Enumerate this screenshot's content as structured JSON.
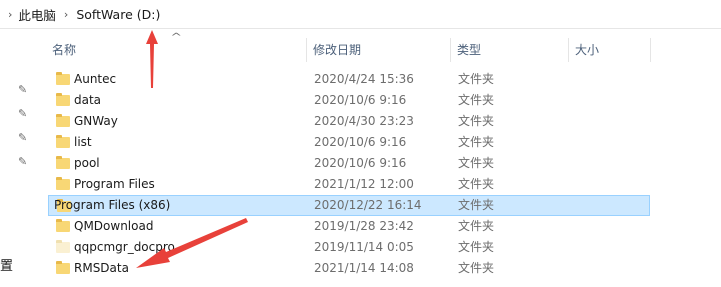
{
  "breadcrumb": {
    "items": [
      "此电脑",
      "SoftWare (D:)"
    ]
  },
  "columns": {
    "name": "名称",
    "date": "修改日期",
    "type": "类型",
    "size": "大小"
  },
  "side_text": "置",
  "files": [
    {
      "name": "Auntec",
      "date": "2020/4/24 15:36",
      "type": "文件夹"
    },
    {
      "name": "data",
      "date": "2020/10/6 9:16",
      "type": "文件夹"
    },
    {
      "name": "GNWay",
      "date": "2020/4/30 23:23",
      "type": "文件夹"
    },
    {
      "name": "list",
      "date": "2020/10/6 9:16",
      "type": "文件夹"
    },
    {
      "name": "pool",
      "date": "2020/10/6 9:16",
      "type": "文件夹"
    },
    {
      "name": "Program Files",
      "date": "2021/1/12 12:00",
      "type": "文件夹"
    },
    {
      "name": "Program Files (x86)",
      "date": "2020/12/22 16:14",
      "type": "文件夹",
      "selected": true
    },
    {
      "name": "QMDownload",
      "date": "2019/1/28 23:42",
      "type": "文件夹"
    },
    {
      "name": "qqpcmgr_docpro",
      "date": "2019/11/14 0:05",
      "type": "文件夹"
    },
    {
      "name": "RMSData",
      "date": "2021/1/14 14:08",
      "type": "文件夹"
    }
  ],
  "colors": {
    "selection_bg": "#cce8ff",
    "selection_border": "#99d1ff",
    "folder": "#f8d775",
    "annotation_arrow": "#e8413a"
  }
}
